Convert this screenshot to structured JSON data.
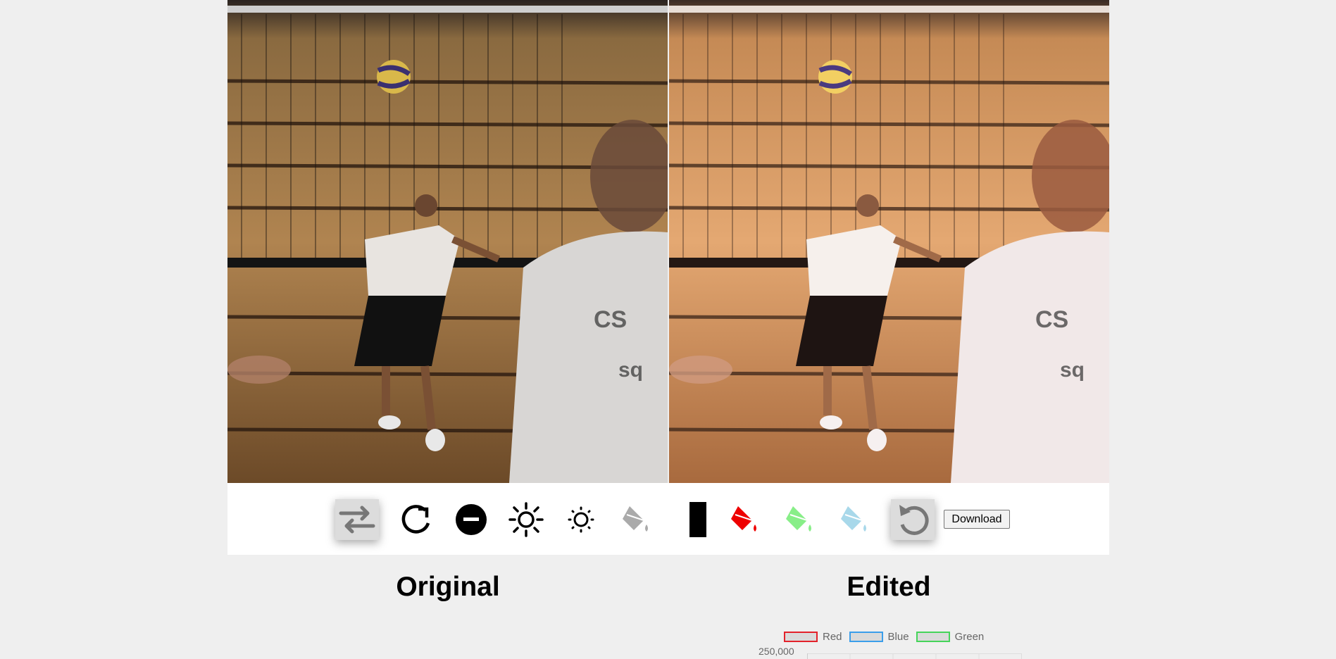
{
  "images": {
    "original_alt": "Original",
    "edited_alt": "Edited"
  },
  "toolbar": {
    "tools": [
      {
        "name": "swap-icon",
        "active": true
      },
      {
        "name": "rotate-icon",
        "active": false
      },
      {
        "name": "invert-icon",
        "active": false
      },
      {
        "name": "brightness-up-icon",
        "active": false
      },
      {
        "name": "brightness-down-icon",
        "active": false
      },
      {
        "name": "grayscale-fill-icon",
        "active": false
      },
      {
        "name": "black-white-icon",
        "active": false
      },
      {
        "name": "red-fill-icon",
        "active": false
      },
      {
        "name": "green-fill-icon",
        "active": false
      },
      {
        "name": "blue-fill-icon",
        "active": false
      },
      {
        "name": "undo-icon",
        "active": true
      }
    ],
    "download_label": "Download"
  },
  "labels": {
    "original": "Original",
    "edited": "Edited"
  },
  "histogram": {
    "legend": [
      {
        "label": "Red",
        "color": "#e3222b"
      },
      {
        "label": "Blue",
        "color": "#3b9eea"
      },
      {
        "label": "Green",
        "color": "#45d45a"
      }
    ],
    "y_tick_top": "250,000"
  },
  "colors": {
    "page_bg": "#efefef",
    "toolbar_bg": "#ffffff",
    "red": "#ee0000",
    "green": "#88ee88",
    "blue": "#a8d8ea"
  }
}
